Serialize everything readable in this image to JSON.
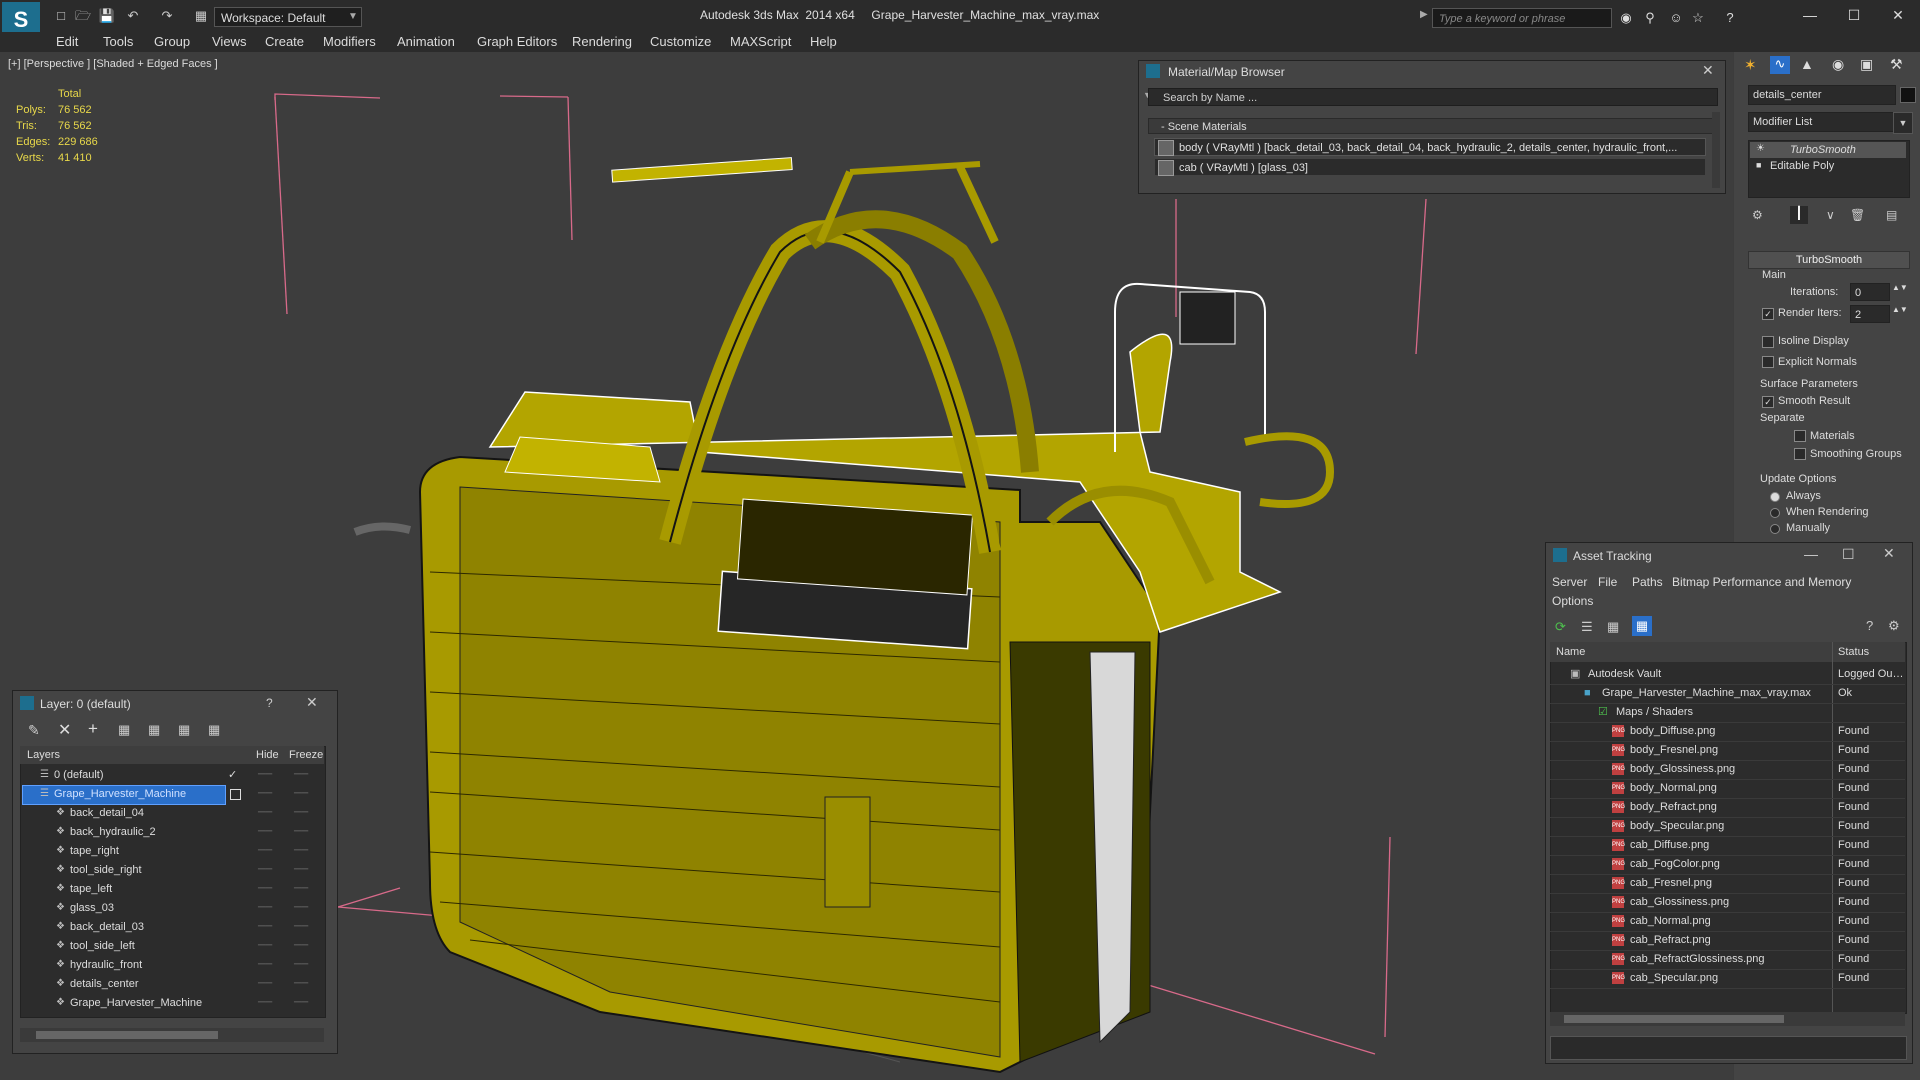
{
  "titlebar": {
    "workspace": "Workspace: Default",
    "title": "Autodesk 3ds Max  2014 x64     Grape_Harvester_Machine_max_vray.max",
    "search_placeholder": "Type a keyword or phrase"
  },
  "menu": [
    "Edit",
    "Tools",
    "Group",
    "Views",
    "Create",
    "Modifiers",
    "Animation",
    "Graph Editors",
    "Rendering",
    "Customize",
    "MAXScript",
    "Help"
  ],
  "viewport": {
    "label": "[+] [Perspective ] [Shaded + Edged Faces ]",
    "stats_header": "Total",
    "stats": [
      {
        "label": "Polys:",
        "value": "76 562"
      },
      {
        "label": "Tris:",
        "value": "76 562"
      },
      {
        "label": "Edges:",
        "value": "229 686"
      },
      {
        "label": "Verts:",
        "value": "41 410"
      }
    ]
  },
  "material_browser": {
    "title": "Material/Map Browser",
    "search_placeholder": "Search by Name ...",
    "section": "- Scene Materials",
    "materials": [
      "body  ( VRayMtl ) [back_detail_03, back_detail_04, back_hydraulic_2, details_center, hydraulic_front,...",
      "cab  ( VRayMtl ) [glass_03]"
    ]
  },
  "command_panel": {
    "object_name": "details_center",
    "modifier_list": "Modifier List",
    "stack": [
      "TurboSmooth",
      "Editable Poly"
    ],
    "rollout_title": "TurboSmooth",
    "main_label": "Main",
    "iterations_label": "Iterations:",
    "iterations_value": "0",
    "render_iters_label": "Render Iters:",
    "render_iters_value": "2",
    "isoline_display": "Isoline Display",
    "explicit_normals": "Explicit Normals",
    "surface_parameters": "Surface Parameters",
    "smooth_result": "Smooth Result",
    "separate": "Separate",
    "materials": "Materials",
    "smoothing_groups": "Smoothing Groups",
    "update_options": "Update Options",
    "always": "Always",
    "when_rendering": "When Rendering",
    "manually": "Manually"
  },
  "layer_window": {
    "title": "Layer: 0 (default)",
    "help": "?",
    "col_layers": "Layers",
    "col_hide": "Hide",
    "col_freeze": "Freeze",
    "rows": [
      {
        "name": "0 (default)",
        "indent": 0,
        "kind": "layer"
      },
      {
        "name": "Grape_Harvester_Machine",
        "indent": 0,
        "kind": "layer-selected"
      },
      {
        "name": "back_detail_04",
        "indent": 1,
        "kind": "object"
      },
      {
        "name": "back_hydraulic_2",
        "indent": 1,
        "kind": "object"
      },
      {
        "name": "tape_right",
        "indent": 1,
        "kind": "object"
      },
      {
        "name": "tool_side_right",
        "indent": 1,
        "kind": "object"
      },
      {
        "name": "tape_left",
        "indent": 1,
        "kind": "object"
      },
      {
        "name": "glass_03",
        "indent": 1,
        "kind": "object"
      },
      {
        "name": "back_detail_03",
        "indent": 1,
        "kind": "object"
      },
      {
        "name": "tool_side_left",
        "indent": 1,
        "kind": "object"
      },
      {
        "name": "hydraulic_front",
        "indent": 1,
        "kind": "object"
      },
      {
        "name": "details_center",
        "indent": 1,
        "kind": "object"
      },
      {
        "name": "Grape_Harvester_Machine",
        "indent": 1,
        "kind": "object"
      }
    ]
  },
  "asset_tracking": {
    "title": "Asset Tracking",
    "menu": [
      "Server",
      "File",
      "Paths",
      "Bitmap Performance and Memory",
      "Options"
    ],
    "col_name": "Name",
    "col_status": "Status",
    "rows": [
      {
        "name": "Autodesk Vault",
        "status": "Logged Out ...",
        "indent": 0,
        "icon": "vault"
      },
      {
        "name": "Grape_Harvester_Machine_max_vray.max",
        "status": "Ok",
        "indent": 1,
        "icon": "max"
      },
      {
        "name": "Maps / Shaders",
        "status": "",
        "indent": 2,
        "icon": "maps"
      },
      {
        "name": "body_Diffuse.png",
        "status": "Found",
        "indent": 3,
        "icon": "png"
      },
      {
        "name": "body_Fresnel.png",
        "status": "Found",
        "indent": 3,
        "icon": "png"
      },
      {
        "name": "body_Glossiness.png",
        "status": "Found",
        "indent": 3,
        "icon": "png"
      },
      {
        "name": "body_Normal.png",
        "status": "Found",
        "indent": 3,
        "icon": "png"
      },
      {
        "name": "body_Refract.png",
        "status": "Found",
        "indent": 3,
        "icon": "png"
      },
      {
        "name": "body_Specular.png",
        "status": "Found",
        "indent": 3,
        "icon": "png"
      },
      {
        "name": "cab_Diffuse.png",
        "status": "Found",
        "indent": 3,
        "icon": "png"
      },
      {
        "name": "cab_FogColor.png",
        "status": "Found",
        "indent": 3,
        "icon": "png"
      },
      {
        "name": "cab_Fresnel.png",
        "status": "Found",
        "indent": 3,
        "icon": "png"
      },
      {
        "name": "cab_Glossiness.png",
        "status": "Found",
        "indent": 3,
        "icon": "png"
      },
      {
        "name": "cab_Normal.png",
        "status": "Found",
        "indent": 3,
        "icon": "png"
      },
      {
        "name": "cab_Refract.png",
        "status": "Found",
        "indent": 3,
        "icon": "png"
      },
      {
        "name": "cab_RefractGlossiness.png",
        "status": "Found",
        "indent": 3,
        "icon": "png"
      },
      {
        "name": "cab_Specular.png",
        "status": "Found",
        "indent": 3,
        "icon": "png"
      }
    ]
  },
  "colors": {
    "model_yellow": "#a89a00",
    "stats_yellow": "#e8d84a",
    "selection_blue": "#2a6fc9",
    "bg_dark": "#2b2b2b"
  }
}
